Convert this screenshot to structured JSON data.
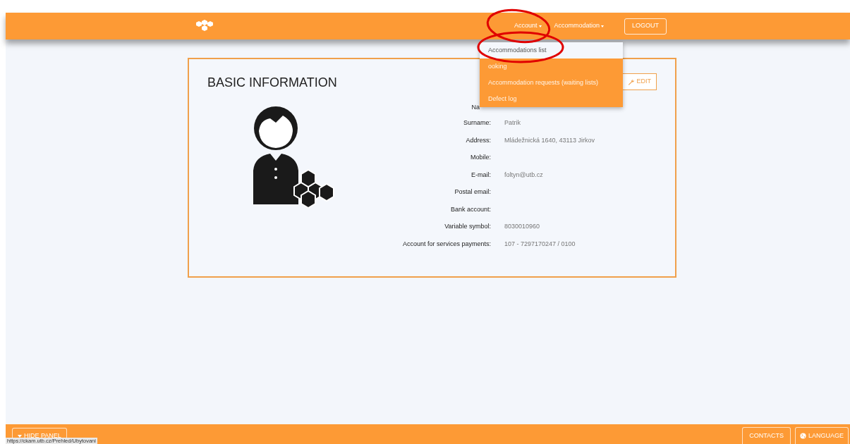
{
  "nav": {
    "menus": [
      {
        "label": "Account"
      },
      {
        "label": "Accommodation"
      }
    ],
    "logout": "LOGOUT"
  },
  "dropdown": [
    {
      "label": "Accommodations list",
      "selected": true
    },
    {
      "label": "ooking",
      "selected": false
    },
    {
      "label": "Accommodation requests (waiting lists)",
      "selected": false
    },
    {
      "label": "Defect log",
      "selected": false
    }
  ],
  "card": {
    "title": "BASIC INFORMATION",
    "edit": "EDIT",
    "fields": [
      {
        "label": "Na",
        "kind": "cut"
      },
      {
        "label": "Surname:",
        "value": "Patrik"
      },
      {
        "label": "Address:",
        "value": "Mládežnická 1640, 43113 Jirkov"
      },
      {
        "label": "Mobile:"
      },
      {
        "label": "E-mail:",
        "value": "foltyn@utb.cz"
      },
      {
        "label": "Postal email:"
      },
      {
        "label": "Bank account:"
      },
      {
        "label": "Variable symbol:",
        "value": "8030010960"
      },
      {
        "label": "Account for services payments:",
        "value": "107 - 7297170247 / 0100"
      }
    ]
  },
  "footer": {
    "hide_panel": "HIDE PANEL",
    "contacts": "CONTACTS",
    "language": "LANGUAGE"
  },
  "status_url": "https://ckam.utb.cz/Prehled/Ubytovani"
}
